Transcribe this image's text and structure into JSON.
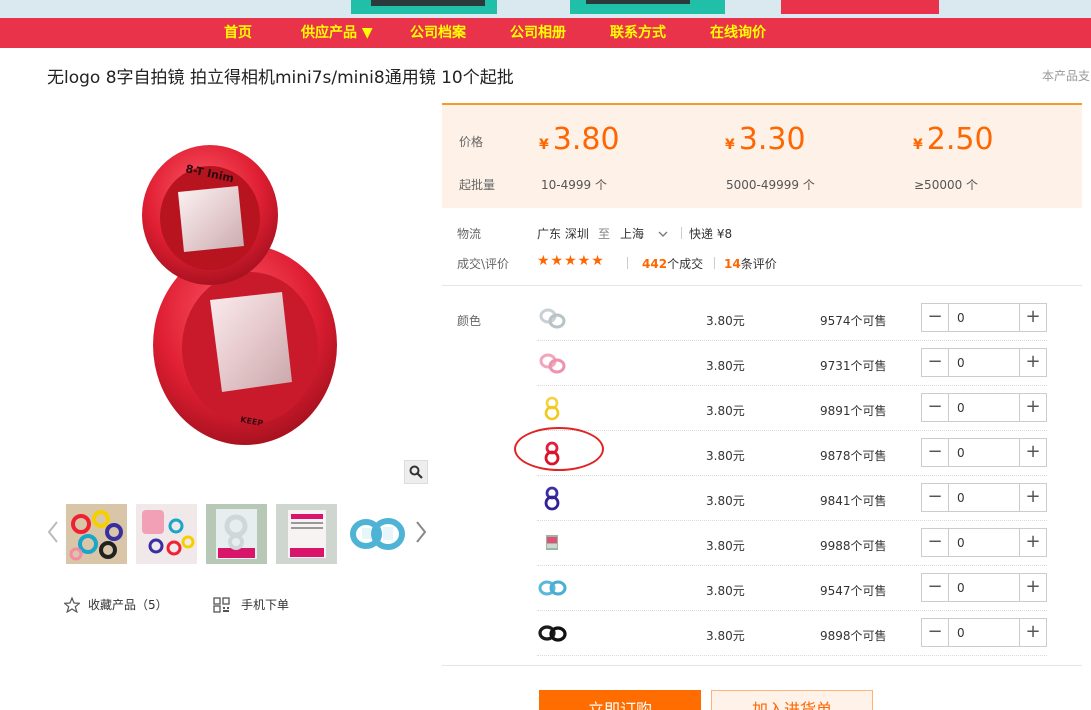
{
  "nav": {
    "items": [
      "首页",
      "供应产品 ▼",
      "公司档案",
      "公司相册",
      "联系方式",
      "在线询价"
    ]
  },
  "product": {
    "title": "无logo 8字自拍镜 拍立得相机mini7s/mini8通用镜 10个起批",
    "side_note": "本产品支"
  },
  "price_panel": {
    "price_label": "价格",
    "moq_label": "起批量",
    "currency": "¥",
    "tiers": [
      {
        "price": "3.80",
        "qty": "10-4999 个"
      },
      {
        "price": "3.30",
        "qty": "5000-49999 个"
      },
      {
        "price": "2.50",
        "qty": "≥50000 个"
      }
    ]
  },
  "logistics": {
    "label": "物流",
    "from": "广东 深圳",
    "to_word": "至",
    "dest": "上海",
    "express": "快递 ¥8"
  },
  "deals": {
    "label": "成交\\评价",
    "stars": "★★★★★",
    "deals_count": "442",
    "deals_suffix": "个成交",
    "reviews_count": "14",
    "reviews_suffix": "条评价"
  },
  "variants": {
    "label": "颜色",
    "rows": [
      {
        "icon": "clear-lens-icon",
        "price": "3.80元",
        "stock": "9574个可售",
        "value": "0"
      },
      {
        "icon": "pink-lens-icon",
        "price": "3.80元",
        "stock": "9731个可售",
        "value": "0"
      },
      {
        "icon": "yellow-lens-icon",
        "price": "3.80元",
        "stock": "9891个可售",
        "value": "0"
      },
      {
        "icon": "red-lens-icon",
        "price": "3.80元",
        "stock": "9878个可售",
        "value": "0"
      },
      {
        "icon": "purple-lens-icon",
        "price": "3.80元",
        "stock": "9841个可售",
        "value": "0"
      },
      {
        "icon": "packaged-lens-icon",
        "price": "3.80元",
        "stock": "9988个可售",
        "value": "0"
      },
      {
        "icon": "blue-lens-icon",
        "price": "3.80元",
        "stock": "9547个可售",
        "value": "0"
      },
      {
        "icon": "black-lens-icon",
        "price": "3.80元",
        "stock": "9898个可售",
        "value": "0"
      }
    ]
  },
  "actions": {
    "favorite": "收藏产品（5）",
    "mobile_order": "手机下单",
    "buy_now": "立即订购",
    "add_to_cart": "加入进货单"
  },
  "colors": {
    "nav_bg": "#e8334a",
    "nav_text": "#ffff00",
    "accent": "#ff6600"
  }
}
